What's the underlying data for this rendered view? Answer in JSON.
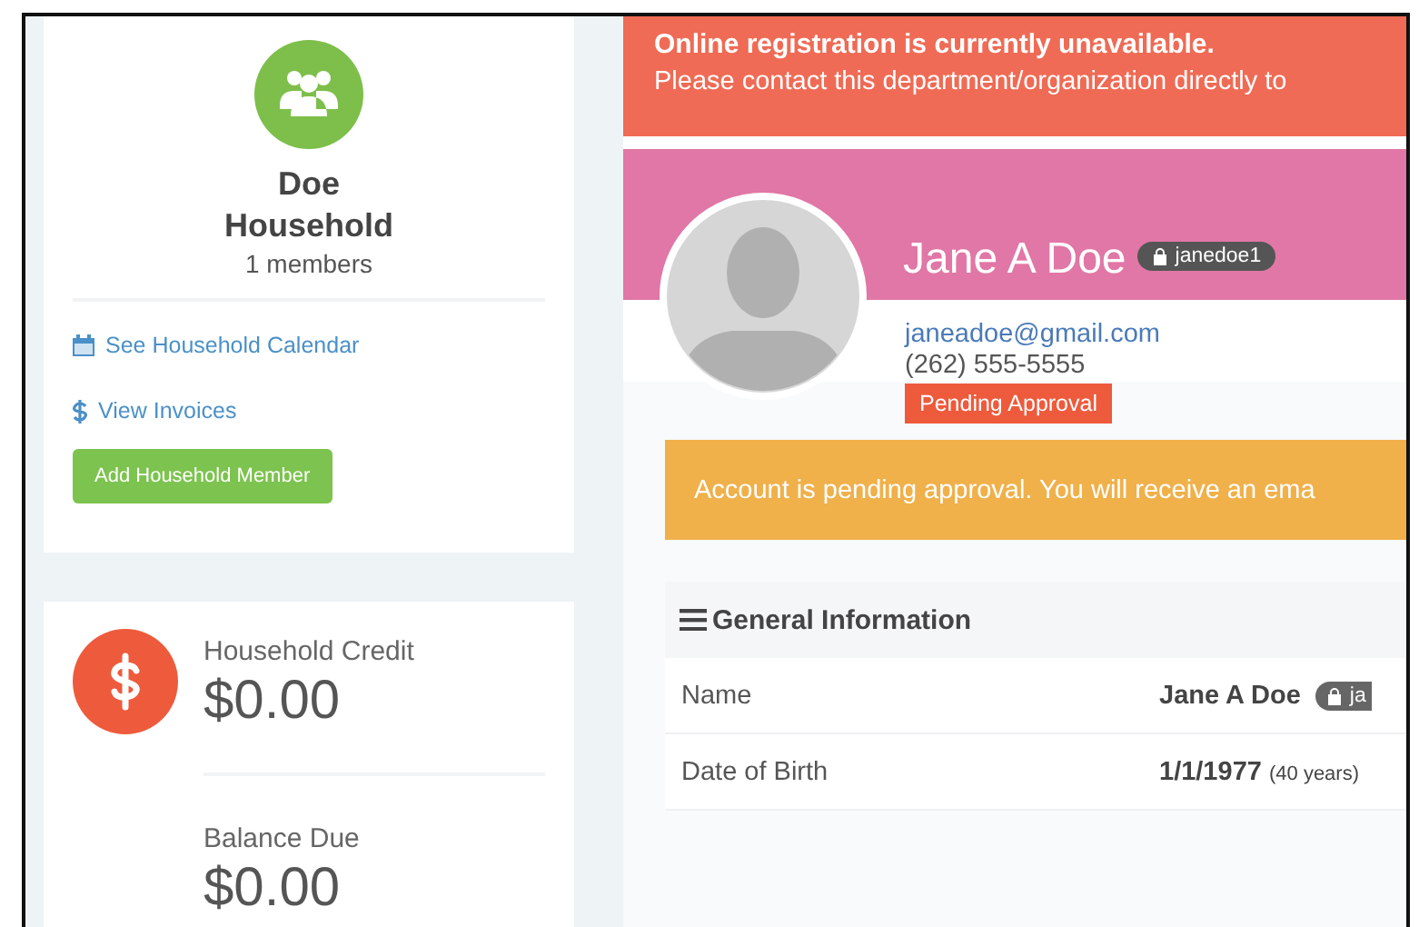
{
  "household": {
    "name": "Doe Household",
    "members": "1 members",
    "links": [
      {
        "kind": "calendar",
        "label": "See Household Calendar"
      },
      {
        "kind": "dollar",
        "label": "View Invoices"
      }
    ],
    "button": "Add Household Member"
  },
  "balances": [
    {
      "label": "Household Credit",
      "amount": "$0.00"
    },
    {
      "label": "Balance Due",
      "amount": "$0.00"
    }
  ],
  "banner": {
    "title": "Online registration is currently unavailable.",
    "text": "Please contact this department/organization directly to"
  },
  "profile": {
    "name": "Jane A Doe",
    "username": "janedoe1",
    "email": "janeadoe@gmail.com",
    "phone": "(262) 555-5555",
    "status": "Pending Approval"
  },
  "alert": "Account is pending approval. You will receive an ema",
  "general_information": {
    "title": "General Information",
    "rows": [
      {
        "label": "Name",
        "value": "Jane A Doe",
        "username": "ja"
      },
      {
        "label": "Date of Birth",
        "value": "1/1/1977",
        "note": "(40 years)"
      }
    ]
  }
}
